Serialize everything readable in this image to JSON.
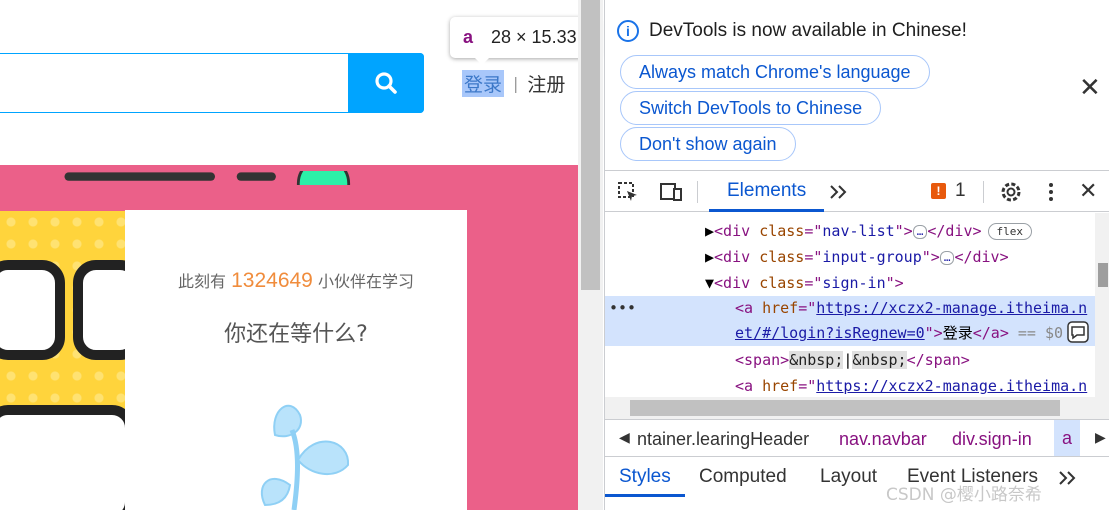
{
  "page": {
    "login_label": "登录",
    "separator": "|",
    "register_label": "注册",
    "banner": {
      "prefix": "此刻有",
      "count": "1324649",
      "suffix": "小伙伴在学习",
      "question": "你还在等什么?"
    }
  },
  "tooltip": {
    "tag": "a",
    "size": "28 × 15.33"
  },
  "devtools": {
    "notice": {
      "message": "DevTools is now available in Chinese!",
      "btn_match": "Always match Chrome's language",
      "btn_switch": "Switch DevTools to Chinese",
      "btn_dont": "Don't show again"
    },
    "toolbar": {
      "tab_elements": "Elements",
      "issues_count": "1"
    },
    "dom": {
      "row1": {
        "tag": "div",
        "attr": "class",
        "val": "nav-list"
      },
      "row2": {
        "tag": "div",
        "attr": "class",
        "val": "input-group"
      },
      "row3": {
        "tag": "div",
        "attr": "class",
        "val": "sign-in"
      },
      "row4": {
        "href_a": "https://xczx2-manage.itheima.n",
        "href_b": "et/#/login?isRegnew=0",
        "text": "登录",
        "suffix": "== $0"
      },
      "row5": {
        "nbsp": "&nbsp;",
        "sep": "|"
      },
      "row6": {
        "href": "https://xczx2-manage.itheima.n"
      },
      "flex_badge": "flex",
      "ellipsis": "…"
    },
    "breadcrumbs": [
      "ntainer.learingHeader",
      "nav.navbar",
      "div.sign-in",
      "a"
    ],
    "subtabs": [
      "Styles",
      "Computed",
      "Layout",
      "Event Listeners"
    ]
  },
  "watermark": "CSDN @樱小路奈希"
}
